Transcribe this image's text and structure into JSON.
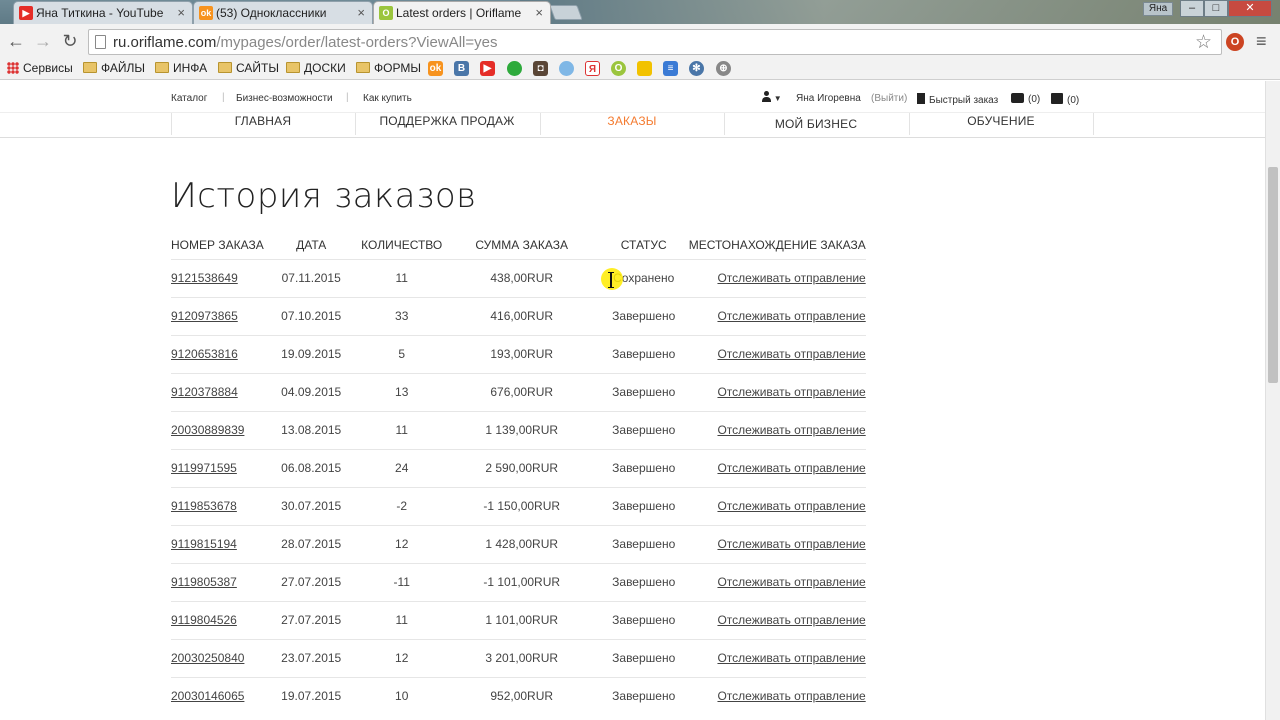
{
  "browser": {
    "tabs": [
      {
        "title": "Яна Титкина - YouTube",
        "favicon": "youtube-icon",
        "color": "#e52d27"
      },
      {
        "title": "(53) Одноклассники",
        "favicon": "odnoklassniki-icon",
        "color": "#f7931e"
      },
      {
        "title": "Latest orders | Oriflame",
        "favicon": "oriflame-icon",
        "color": "#9bc53d"
      }
    ],
    "window_user": "Яна",
    "url_host": "ru.oriflame.com",
    "url_path": "/mypages/order/latest-orders?ViewAll=yes",
    "bookmarks": [
      {
        "label": "Сервисы",
        "icon": "apps-icon"
      },
      {
        "label": "ФАЙЛЫ",
        "icon": "folder-icon"
      },
      {
        "label": "ИНФА",
        "icon": "folder-icon"
      },
      {
        "label": "САЙТЫ",
        "icon": "folder-icon"
      },
      {
        "label": "ДОСКИ",
        "icon": "folder-icon"
      },
      {
        "label": "ФОРМЫ",
        "icon": "folder-icon"
      }
    ]
  },
  "topnav": {
    "links": [
      "Каталог",
      "Бизнес-возможности",
      "Как купить"
    ],
    "user_name": "Яна Игоревна",
    "logout": "(Выйти)",
    "quick_order": "Быстрый заказ",
    "messages_count": "(0)",
    "cart_count": "(0)"
  },
  "mainnav": {
    "items": [
      "ГЛАВНАЯ",
      "ПОДДЕРЖКА ПРОДАЖ",
      "ЗАКАЗЫ",
      "МОЙ БИЗНЕС",
      "ОБУЧЕНИЕ"
    ],
    "active_color": "#f47b30"
  },
  "page": {
    "title": "История заказов"
  },
  "table": {
    "headers": [
      "НОМЕР ЗАКАЗА",
      "ДАТА",
      "КОЛИЧЕСТВО",
      "СУММА ЗАКАЗА",
      "СТАТУС",
      "МЕСТОНАХОЖДЕНИЕ ЗАКАЗА"
    ],
    "rows": [
      {
        "number": "9121538649",
        "date": "07.11.2015",
        "qty": "11",
        "sum": "438,00RUR",
        "status": "Сохранено",
        "track": "Отслеживать отправление"
      },
      {
        "number": "9120973865",
        "date": "07.10.2015",
        "qty": "33",
        "sum": "416,00RUR",
        "status": "Завершено",
        "track": "Отслеживать отправление"
      },
      {
        "number": "9120653816",
        "date": "19.09.2015",
        "qty": "5",
        "sum": "193,00RUR",
        "status": "Завершено",
        "track": "Отслеживать отправление"
      },
      {
        "number": "9120378884",
        "date": "04.09.2015",
        "qty": "13",
        "sum": "676,00RUR",
        "status": "Завершено",
        "track": "Отслеживать отправление"
      },
      {
        "number": "20030889839",
        "date": "13.08.2015",
        "qty": "11",
        "sum": "1 139,00RUR",
        "status": "Завершено",
        "track": "Отслеживать отправление"
      },
      {
        "number": "9119971595",
        "date": "06.08.2015",
        "qty": "24",
        "sum": "2 590,00RUR",
        "status": "Завершено",
        "track": "Отслеживать отправление"
      },
      {
        "number": "9119853678",
        "date": "30.07.2015",
        "qty": "-2",
        "sum": "-1 150,00RUR",
        "status": "Завершено",
        "track": "Отслеживать отправление"
      },
      {
        "number": "9119815194",
        "date": "28.07.2015",
        "qty": "12",
        "sum": "1 428,00RUR",
        "status": "Завершено",
        "track": "Отслеживать отправление"
      },
      {
        "number": "9119805387",
        "date": "27.07.2015",
        "qty": "-11",
        "sum": "-1 101,00RUR",
        "status": "Завершено",
        "track": "Отслеживать отправление"
      },
      {
        "number": "9119804526",
        "date": "27.07.2015",
        "qty": "11",
        "sum": "1 101,00RUR",
        "status": "Завершено",
        "track": "Отслеживать отправление"
      },
      {
        "number": "20030250840",
        "date": "23.07.2015",
        "qty": "12",
        "sum": "3 201,00RUR",
        "status": "Завершено",
        "track": "Отслеживать отправление"
      },
      {
        "number": "20030146065",
        "date": "19.07.2015",
        "qty": "10",
        "sum": "952,00RUR",
        "status": "Завершено",
        "track": "Отслеживать отправление"
      }
    ]
  }
}
